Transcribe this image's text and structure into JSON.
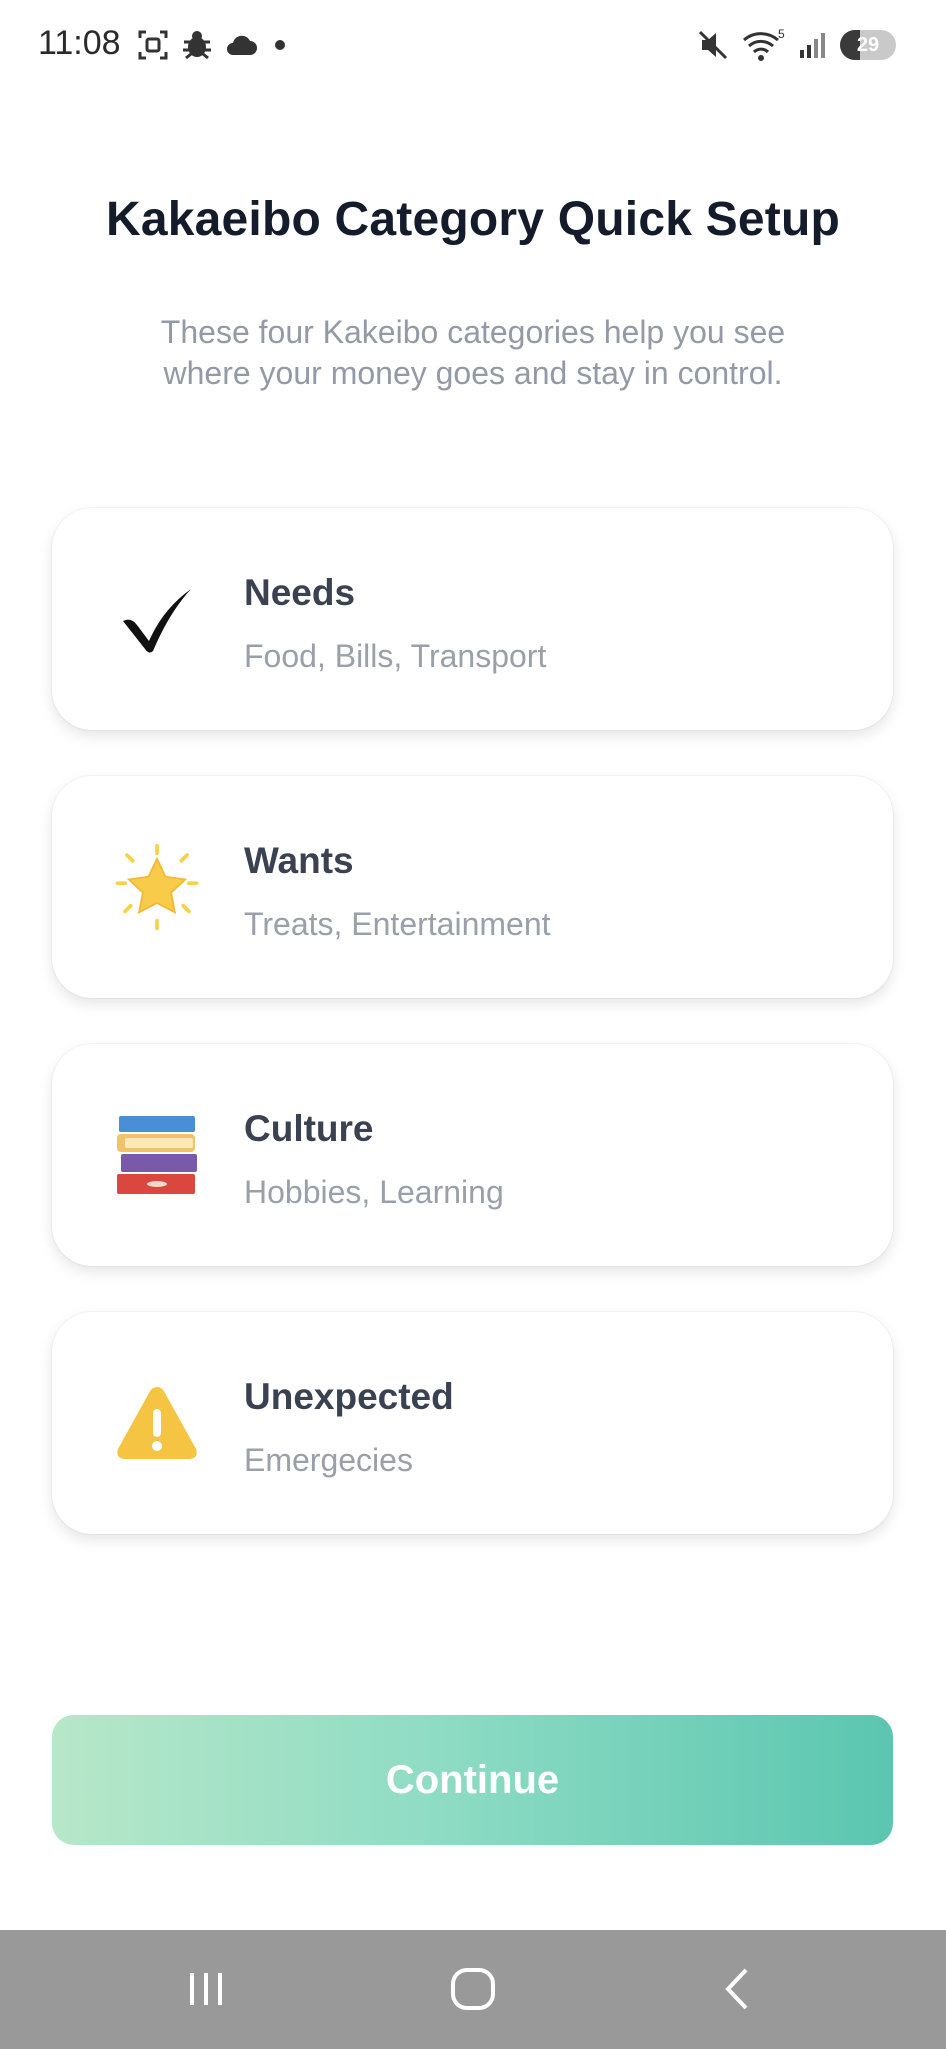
{
  "status_bar": {
    "time": "11:08",
    "battery_level": "29",
    "left_icons": [
      "screenshot-icon",
      "bug-icon",
      "cloud-icon",
      "dot-icon"
    ],
    "right_icons": [
      "mute-icon",
      "wifi-icon",
      "signal-icon",
      "battery-icon"
    ],
    "wifi_badge": "5"
  },
  "header": {
    "title": "Kakaeibo Category Quick Setup",
    "subtitle": "These four Kakeibo categories help you see where your money goes and stay in control."
  },
  "categories": [
    {
      "title": "Needs",
      "description": "Food, Bills, Transport",
      "icon": "checkmark-icon"
    },
    {
      "title": "Wants",
      "description": "Treats, Entertainment",
      "icon": "star-icon"
    },
    {
      "title": "Culture",
      "description": "Hobbies, Learning",
      "icon": "books-icon"
    },
    {
      "title": "Unexpected",
      "description": "Emergecies",
      "icon": "warning-icon"
    }
  ],
  "actions": {
    "continue_label": "Continue"
  },
  "colors": {
    "button_gradient_start": "#b7e7c9",
    "button_gradient_end": "#5bc6b0",
    "nav_bar": "#999999"
  }
}
